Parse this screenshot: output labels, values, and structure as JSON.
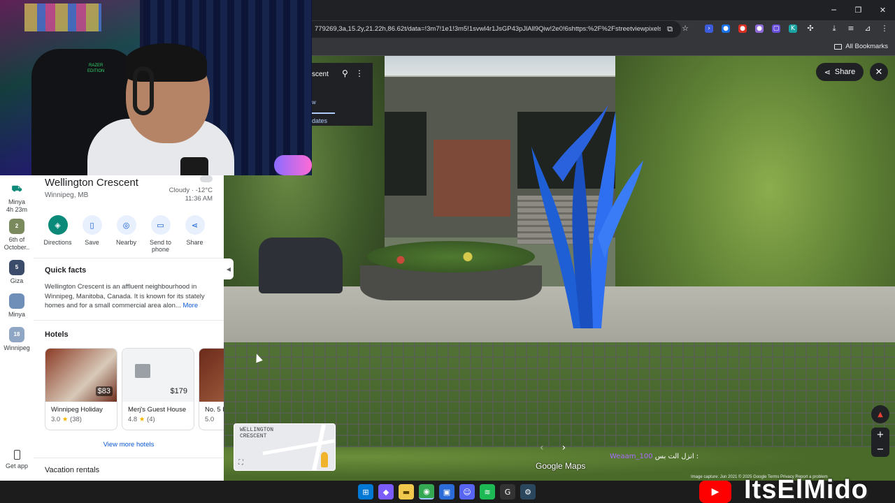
{
  "browser": {
    "url": "779269,3a,15.2y,21.22h,86.62t/data=!3m7!1e1!3m5!1svwl4r1JsGP43pJlAll9Qiw!2e0!6shttps:%2F%2Fstreetviewpixels-pa...",
    "bookmarks_folder": "All Bookmarks",
    "controls": {
      "minimize": "─",
      "maximize": "❐",
      "close": "✕"
    }
  },
  "webcam": {
    "chair_logo": "RAZER\nEDITION"
  },
  "rail": {
    "items": [
      {
        "label": "Minya\n4h 23m",
        "icon": "bus-icon",
        "color": "#0b8a7a"
      },
      {
        "label": "6th of\nOctober..",
        "badge": "2",
        "color": "#7b8a5c"
      },
      {
        "label": "Giza",
        "badge": "5",
        "color": "#3b4b6a"
      },
      {
        "label": "Minya",
        "badge": "",
        "color": "#6f8fb8"
      },
      {
        "label": "Winnipeg",
        "badge": "18",
        "color": "#8fa7c4"
      }
    ],
    "get_app": "Get app"
  },
  "place": {
    "title": "Wellington Crescent",
    "subtitle": "Winnipeg, MB",
    "weather": "Cloudy · -12°C",
    "time": "11:36 AM",
    "actions": [
      {
        "label": "Directions",
        "icon": "directions-icon"
      },
      {
        "label": "Save",
        "icon": "bookmark-icon"
      },
      {
        "label": "Nearby",
        "icon": "nearby-icon"
      },
      {
        "label": "Send to\nphone",
        "icon": "send-to-phone-icon"
      },
      {
        "label": "Share",
        "icon": "share-icon"
      }
    ],
    "quick_facts_title": "Quick facts",
    "quick_facts": "Wellington Crescent is an affluent neighbourhood in Winnipeg, Manitoba, Canada. It is known for its stately homes and for a small commercial area alon...",
    "more": "More",
    "hotels_title": "Hotels",
    "hotels": [
      {
        "name": "Winnipeg Holiday",
        "price": "$83",
        "rating": "3.0",
        "reviews": "(38)"
      },
      {
        "name": "Merj's Guest House",
        "price": "$179",
        "rating": "4.8",
        "reviews": "(4)"
      },
      {
        "name": "No. 5 B",
        "price": "",
        "rating": "5.0",
        "reviews": ""
      }
    ],
    "view_more": "View more hotels",
    "vacation_title": "Vacation rentals"
  },
  "streetview": {
    "panel_title": "scent",
    "panel_sub": "w",
    "panel_dates": "dates",
    "share": "Share",
    "minimap_label": "WELLINGTON\nCRESCENT",
    "logo": "Google Maps",
    "stream_user": "Weaam_100",
    "stream_text": "انزل الت بس :",
    "footer": "Image capture: Jun 2021   © 2025 Google   Terms   Privacy   Report a problem"
  },
  "taskbar": {
    "apps": [
      {
        "name": "windows-start-icon",
        "glyph": "⊞",
        "color": "#0078d4"
      },
      {
        "name": "copilot-icon",
        "glyph": "◆",
        "color": "#7a5cff"
      },
      {
        "name": "file-explorer-icon",
        "glyph": "▬",
        "color": "#f2c94c"
      },
      {
        "name": "chrome-icon",
        "glyph": "◉",
        "color": "#34a853"
      },
      {
        "name": "store-icon",
        "glyph": "▣",
        "color": "#2b6cd8"
      },
      {
        "name": "discord-icon",
        "glyph": "☺",
        "color": "#5865f2"
      },
      {
        "name": "spotify-icon",
        "glyph": "≋",
        "color": "#1db954"
      },
      {
        "name": "logitech-icon",
        "glyph": "G",
        "color": "#333333"
      },
      {
        "name": "steam-icon",
        "glyph": "⚙",
        "color": "#2a475e"
      }
    ]
  },
  "brand": {
    "name": "ItsElMido"
  }
}
